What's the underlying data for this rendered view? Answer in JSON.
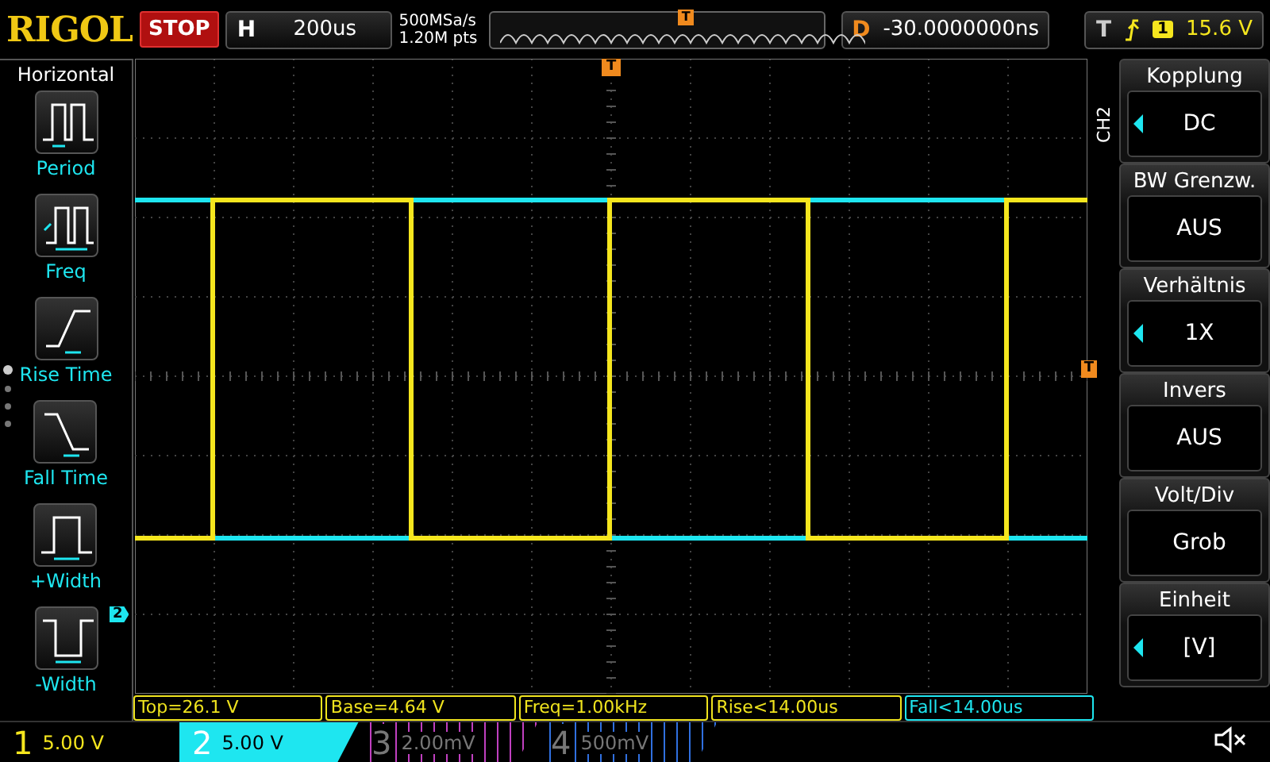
{
  "top_bar": {
    "logo": "RIGOL",
    "run_state": "STOP",
    "timebase": {
      "label": "H",
      "value": "200us"
    },
    "sample_rate": "500MSa/s",
    "memory_depth": "1.20M pts",
    "memory_marker": "T",
    "delay": {
      "label": "D",
      "value": "-30.0000000ns"
    },
    "trigger": {
      "label": "T",
      "source": "1",
      "level": "15.6 V"
    }
  },
  "left_menu": {
    "title": "Horizontal",
    "items": [
      {
        "kind": "period",
        "label": "Period"
      },
      {
        "kind": "freq",
        "label": "Freq"
      },
      {
        "kind": "rise",
        "label": "Rise Time"
      },
      {
        "kind": "fall",
        "label": "Fall Time"
      },
      {
        "kind": "pwidth",
        "label": "+Width"
      },
      {
        "kind": "nwidth",
        "label": "-Width"
      }
    ]
  },
  "screen": {
    "trigger_position_marker": "T",
    "trigger_level_marker": "T",
    "channel_marker": "2"
  },
  "measurements": [
    {
      "text": "Top=26.1 V",
      "color": "#f0e41e"
    },
    {
      "text": "Base=4.64 V",
      "color": "#f0e41e"
    },
    {
      "text": "Freq=1.00kHz",
      "color": "#f0e41e"
    },
    {
      "text": "Rise<14.00us",
      "color": "#f0e41e"
    },
    {
      "text": "Fall<14.00us",
      "color": "#1ee6f0"
    }
  ],
  "right_menu": {
    "channel": "CH2",
    "items": [
      {
        "title": "Kopplung",
        "value": "DC",
        "adjustable": true
      },
      {
        "title": "BW Grenzw.",
        "value": "AUS",
        "adjustable": false
      },
      {
        "title": "Verhältnis",
        "value": "1X",
        "adjustable": true
      },
      {
        "title": "Invers",
        "value": "AUS",
        "adjustable": false
      },
      {
        "title": "Volt/Div",
        "value": "Grob",
        "adjustable": false
      },
      {
        "title": "Einheit",
        "value": "[V]",
        "adjustable": true
      }
    ]
  },
  "channels": [
    {
      "number": "1",
      "scale": "5.00 V",
      "color": "#f5e61e",
      "enabled": true,
      "selected": false
    },
    {
      "number": "2",
      "scale": "5.00 V",
      "color": "#1ee6f0",
      "enabled": true,
      "selected": true
    },
    {
      "number": "3",
      "scale": "2.00mV",
      "color": "#c040c0",
      "enabled": false,
      "selected": false
    },
    {
      "number": "4",
      "scale": "500mV",
      "color": "#3070e0",
      "enabled": false,
      "selected": false
    }
  ],
  "sound": {
    "muted": true
  }
}
